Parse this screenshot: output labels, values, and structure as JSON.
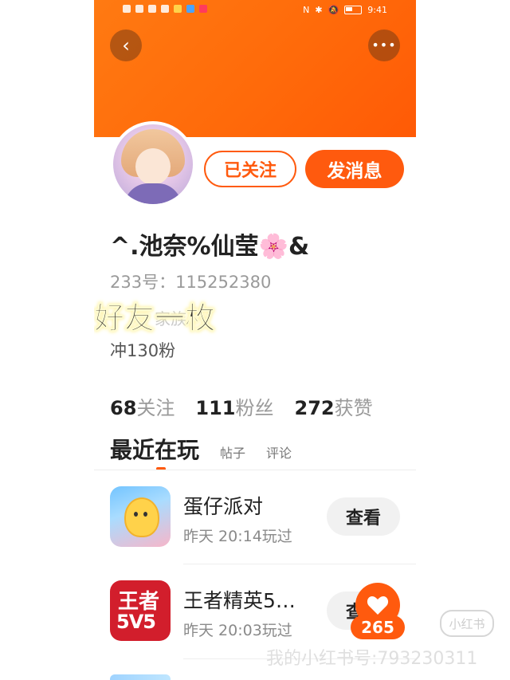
{
  "status_bar": {
    "left_icons": [
      "hd-icon",
      "signal-icon",
      "wifi-icon",
      "wechat-icon",
      "weibo-icon",
      "browser-icon",
      "app-icon"
    ],
    "time": "9:41"
  },
  "header": {
    "back_icon": "chevron-left-icon",
    "more_icon": "more-dots-icon"
  },
  "profile": {
    "follow_button": "已关注",
    "message_button": "发消息",
    "username": "^.池奈%仙莹🌸&",
    "uid": "233号：115252380",
    "bio_line1": "好友一枚",
    "bio_faint": "家族",
    "bio_line2": "冲130粉"
  },
  "stats": {
    "following_num": "68",
    "following_label": "关注",
    "fans_num": "111",
    "fans_label": "粉丝",
    "likes_num": "272",
    "likes_label": "获赞"
  },
  "tabs": {
    "active": "最近在玩",
    "posts": "帖子",
    "comments": "评论"
  },
  "games": [
    {
      "title": "蛋仔派对",
      "time": "昨天 20:14玩过",
      "button": "查看"
    },
    {
      "title": "王者精英5…",
      "time": "昨天 20:03玩过",
      "button": "查看",
      "icon_text_1": "王者",
      "icon_text_2": "5V5"
    }
  ],
  "like": {
    "count": "265"
  },
  "watermark": {
    "text": "我的小红书号:793230311",
    "logo": "小红书"
  },
  "colors": {
    "accent": "#ff5a0e",
    "header_bg": "#ff6a0a"
  }
}
